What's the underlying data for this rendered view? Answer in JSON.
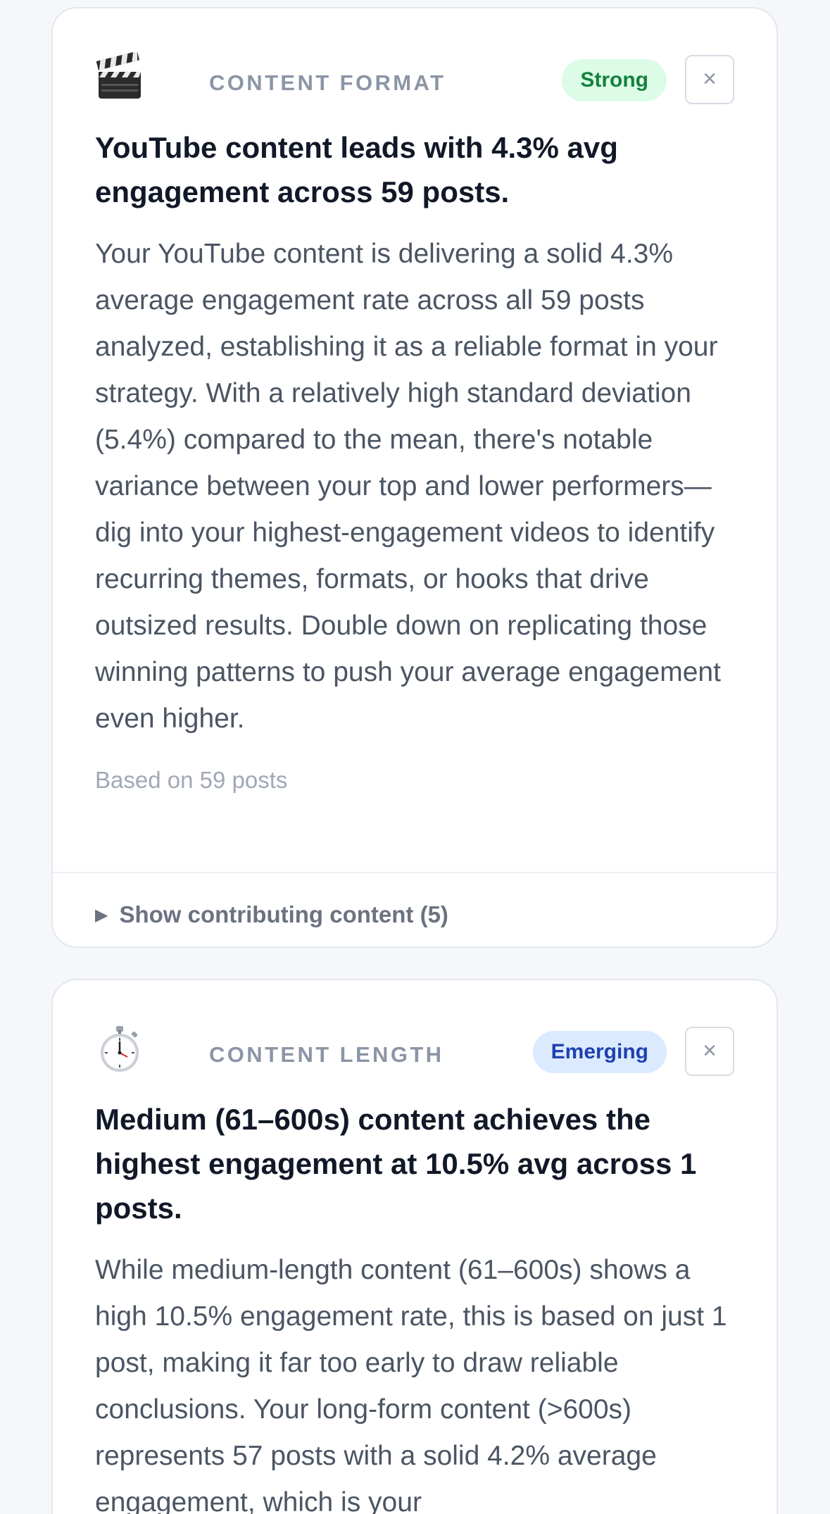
{
  "cards": [
    {
      "icon": "clapper-board-icon",
      "category": "CONTENT FORMAT",
      "badge": "Strong",
      "dismiss_label": "×",
      "headline": "YouTube content leads with 4.3% avg engagement across 59 posts.",
      "body": "Your YouTube content is delivering a solid 4.3% average engagement rate across all 59 posts analyzed, establishing it as a reliable format in your strategy. With a relatively high standard deviation (5.4%) compared to the mean, there's notable variance between your top and lower performers—dig into your highest-engagement videos to identify recurring themes, formats, or hooks that drive outsized results. Double down on replicating those winning patterns to push your average engagement even higher.",
      "meta": "Based on 59 posts",
      "expander_label": "Show contributing content (5)"
    },
    {
      "icon": "stopwatch-icon",
      "category": "CONTENT LENGTH",
      "badge": "Emerging",
      "dismiss_label": "×",
      "headline": "Medium (61–600s) content achieves the highest engagement at 10.5% avg across 1 posts.",
      "body": "While medium-length content (61–600s) shows a high 10.5% engagement rate, this is based on just 1 post, making it far too early to draw reliable conclusions. Your long-form content (>600s) represents 57 posts with a solid 4.2% average engagement, which is your"
    }
  ]
}
